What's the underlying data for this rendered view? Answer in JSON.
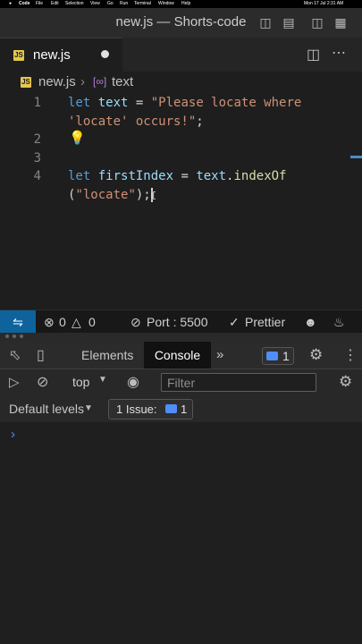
{
  "menubar": {
    "apple": "",
    "items": [
      "Code",
      "File",
      "Edit",
      "Selection",
      "View",
      "Go",
      "Run",
      "Terminal",
      "Window",
      "Help"
    ],
    "clock": "Mon 17 Jul  2:31 AM"
  },
  "window": {
    "title": "new.js — Shorts-code"
  },
  "tab": {
    "icon": "JS",
    "label": "new.js"
  },
  "breadcrumb": {
    "file": "new.js",
    "symbol": "text"
  },
  "editor": {
    "lines": [
      {
        "number": "1",
        "code_a": "let text = \"Please locate where",
        "code_b": "'locate' occurs!\";"
      },
      {
        "number": "2"
      },
      {
        "number": "3"
      },
      {
        "number": "4",
        "code_a": "let firstIndex = text.indexOf",
        "code_b": "(\"locate\");"
      }
    ]
  },
  "statusbar": {
    "errors": "0",
    "warnings": "0",
    "port": "Port : 5500",
    "prettier": "Prettier"
  },
  "devtools": {
    "tabs": [
      "Elements",
      "Console"
    ],
    "active_tab": "Console",
    "message_count": "1",
    "context": "top",
    "filter_placeholder": "Filter",
    "levels": "Default levels",
    "issues_label": "1 Issue:",
    "issues_count": "1",
    "prompt": "›"
  },
  "colors": {
    "accent": "#0e639c",
    "tab_underline": "#e0e0e0",
    "js_icon": "#e6c84e"
  }
}
